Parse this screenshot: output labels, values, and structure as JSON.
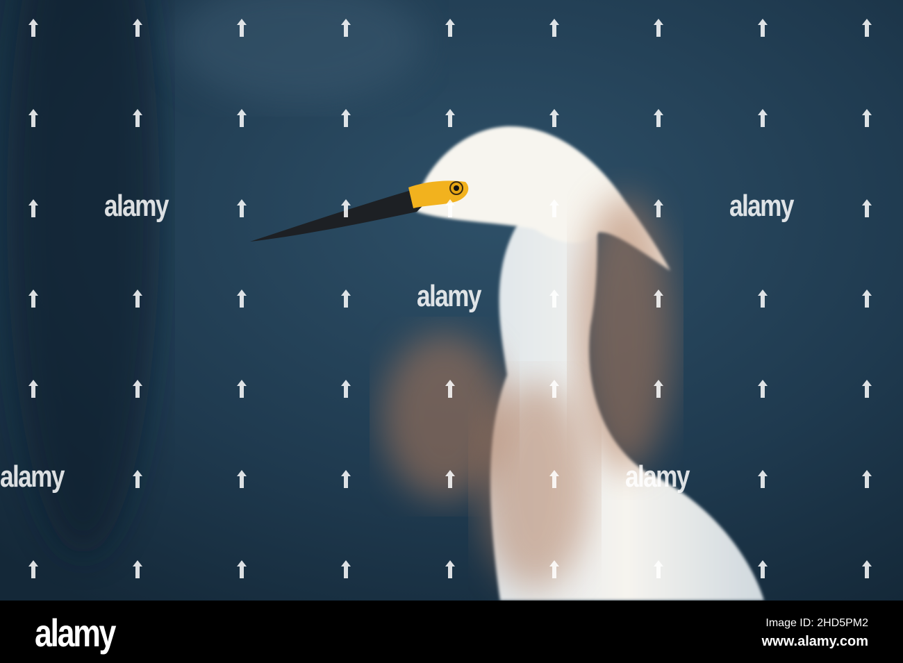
{
  "photo": {
    "subject": "snowy-egret-head",
    "colors": {
      "background": "#1f3a4f",
      "plumage": "#f3f1ec",
      "lore": "#f2b21e",
      "bill": "#1d2024",
      "reeds": "#b07a5c"
    }
  },
  "watermark": {
    "text": "alamy"
  },
  "footer": {
    "logo": "alamy",
    "image_id": "Image ID: 2HD5PM2",
    "url": "www.alamy.com"
  }
}
